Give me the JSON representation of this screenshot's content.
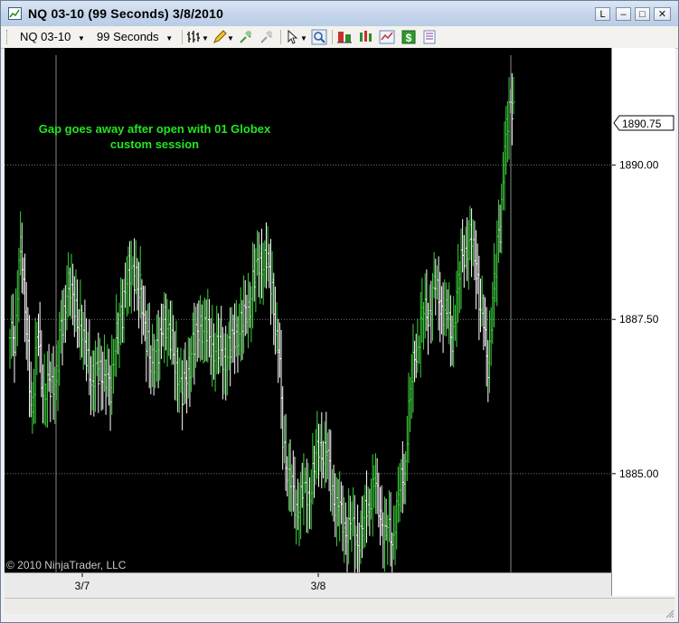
{
  "window": {
    "title": "NQ 03-10 (99 Seconds)  3/8/2010",
    "buttons": {
      "l_label": "L",
      "minimize_label": "–",
      "maximize_label": "□",
      "close_label": "✕"
    }
  },
  "toolbar": {
    "instrument": "NQ 03-10",
    "interval": "99 Seconds",
    "icons": [
      "bar-type-icon",
      "pencil-icon",
      "zoom-in-icon",
      "zoom-out-icon",
      "cursor-icon",
      "magnifier-icon",
      "data-box-icon",
      "indicators-icon",
      "strategies-icon",
      "price-icon",
      "properties-icon"
    ]
  },
  "chart": {
    "annotation_line1": "Gap goes away after open with 01 Globex",
    "annotation_line2": "custom session",
    "copyright": "© 2010 NinjaTrader, LLC",
    "current_price_label": "1890.75",
    "y_ticks": [
      "1890.00",
      "1887.50",
      "1885.00"
    ],
    "x_ticks": [
      "3/7",
      "3/8"
    ],
    "colors": {
      "background": "#000000",
      "up_bar": "#3cd23c",
      "down_bar": "#ffffff",
      "annotation": "#22e622",
      "grid": "#777777"
    }
  },
  "chart_data": {
    "type": "bar",
    "title": "",
    "ylim": [
      1883.4,
      1891.9
    ],
    "y_ticks": [
      1890.0,
      1887.5,
      1885.0
    ],
    "x_tick_labels": [
      "3/7",
      "3/8"
    ],
    "last_price": 1890.75,
    "approx_closes": [
      1887.2,
      1888.6,
      1887.5,
      1886.0,
      1887.3,
      1886.2,
      1886.5,
      1886.5,
      1887.5,
      1888.0,
      1887.8,
      1887.4,
      1887.0,
      1886.5,
      1886.7,
      1886.6,
      1886.4,
      1887.2,
      1887.6,
      1888.3,
      1888.2,
      1888.0,
      1887.2,
      1886.8,
      1887.0,
      1887.5,
      1887.2,
      1886.8,
      1886.3,
      1886.7,
      1887.1,
      1887.4,
      1887.3,
      1887.1,
      1887.0,
      1886.9,
      1887.0,
      1887.3,
      1887.4,
      1887.7,
      1888.1,
      1888.5,
      1888.4,
      1888.1,
      1887.0,
      1885.5,
      1884.8,
      1884.5,
      1884.6,
      1884.7,
      1885.0,
      1885.5,
      1885.3,
      1884.8,
      1884.4,
      1884.2,
      1884.1,
      1884.0,
      1884.0,
      1884.5,
      1884.8,
      1884.4,
      1884.0,
      1884.0,
      1884.5,
      1885.0,
      1886.2,
      1887.0,
      1887.5,
      1887.6,
      1888.0,
      1887.8,
      1887.6,
      1887.2,
      1888.0,
      1888.6,
      1888.8,
      1888.4,
      1887.6,
      1886.8,
      1888.0,
      1889.0,
      1890.5,
      1891.0,
      1890.75
    ]
  }
}
